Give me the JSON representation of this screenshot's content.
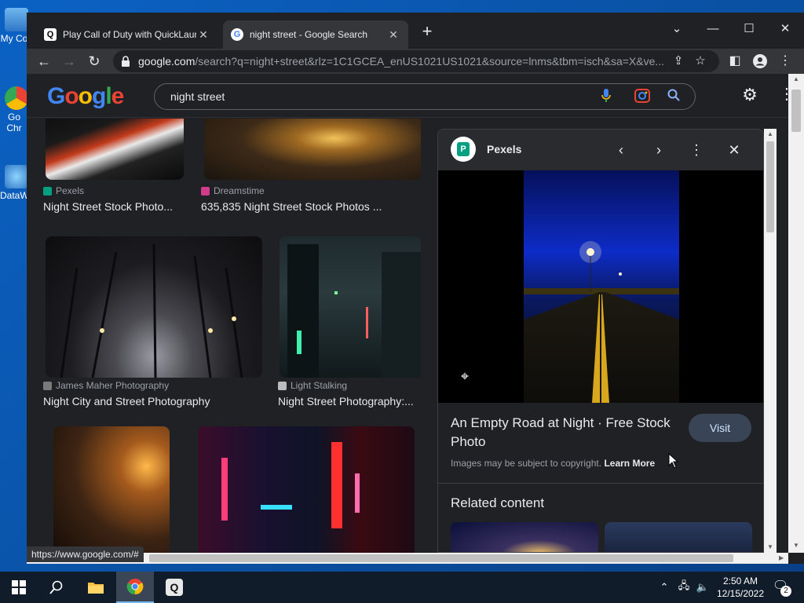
{
  "desktop": {
    "icons": [
      {
        "label": "My Co",
        "icon": "computer-icon"
      },
      {
        "label": "Go Chr",
        "icon": "chrome-shortcut-icon"
      },
      {
        "label": "DataW",
        "icon": "datawrangler-shortcut-icon"
      }
    ]
  },
  "browser": {
    "tabs": [
      {
        "title": "Play Call of Duty with QuickLaunc",
        "icon": "quicklaunch-icon",
        "active": false
      },
      {
        "title": "night street - Google Search",
        "icon": "google-icon",
        "active": true
      }
    ],
    "url_host": "google.com",
    "url_path": "/search?q=night+street&rlz=1C1GCEA_enUS1021US1021&source=lnms&tbm=isch&sa=X&ve...",
    "status_url": "https://www.google.com/#"
  },
  "search": {
    "logo": "Google",
    "query": "night street"
  },
  "results": [
    {
      "source": "Pexels",
      "title": "Night Street Stock Photo..."
    },
    {
      "source": "Dreamstime",
      "title": "635,835 Night Street Stock Photos ..."
    },
    {
      "source": "James Maher Photography",
      "title": "Night City and Street Photography"
    },
    {
      "source": "Light Stalking",
      "title": "Night Street Photography:..."
    }
  ],
  "panel": {
    "source": "Pexels",
    "title": "An Empty Road at Night · Free Stock Photo",
    "visit_label": "Visit",
    "copyright": "Images may be subject to copyright.",
    "learn_more": "Learn More",
    "related_heading": "Related content"
  },
  "taskbar": {
    "time": "2:50 AM",
    "date": "12/15/2022",
    "notification_count": "2"
  },
  "colors": {
    "google_blue": "#4285f4",
    "google_red": "#ea4335",
    "google_yellow": "#fbbc05",
    "google_green": "#34a853",
    "visit_button": "#394457",
    "pexels_green": "#05a081"
  }
}
